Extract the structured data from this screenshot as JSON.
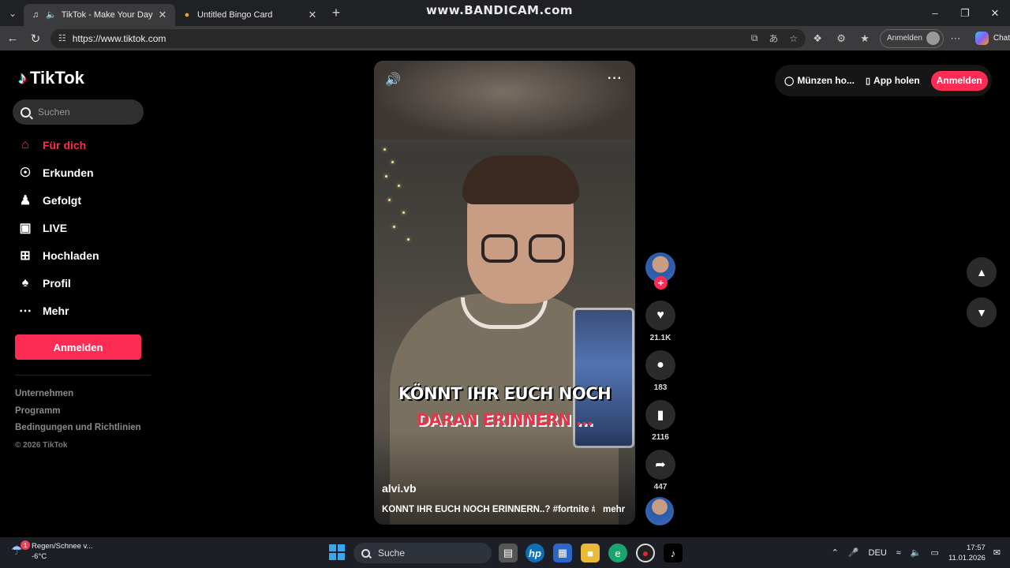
{
  "browser": {
    "tabs": [
      {
        "label": "TikTok - Make Your Day",
        "active": true
      },
      {
        "label": "Untitled Bingo Card",
        "active": false
      }
    ],
    "watermark": "www.BANDICAM.com",
    "url": "https://www.tiktok.com",
    "profile_label": "Anmelden",
    "chat_label": "Chat"
  },
  "sidebar": {
    "logo": "TikTok",
    "search_placeholder": "Suchen",
    "items": [
      {
        "label": "Für dich",
        "icon": "home-icon",
        "active": true
      },
      {
        "label": "Erkunden",
        "icon": "compass-icon"
      },
      {
        "label": "Gefolgt",
        "icon": "following-icon"
      },
      {
        "label": "LIVE",
        "icon": "live-tv-icon"
      },
      {
        "label": "Hochladen",
        "icon": "upload-icon"
      },
      {
        "label": "Profil",
        "icon": "profile-icon"
      },
      {
        "label": "Mehr",
        "icon": "more-dots-icon"
      }
    ],
    "login_button": "Anmelden",
    "footer": [
      "Unternehmen",
      "Programm",
      "Bedingungen und Richtlinien"
    ],
    "copyright": "© 2026 TikTok"
  },
  "video": {
    "overlay_line1": "KÖNNT IHR EUCH NOCH",
    "overlay_line2": "DARAN ERINNERN ...",
    "author": "alvi.vb",
    "description": "KÖNNT IHR EUCH NOCH ERINNERN..? #fortnite #f...",
    "more_label": "mehr"
  },
  "actions": {
    "likes": "21.1K",
    "comments": "183",
    "saves": "2116",
    "shares": "447"
  },
  "topright": {
    "coins": "Münzen ho...",
    "app": "App holen",
    "login": "Anmelden"
  },
  "taskbar": {
    "weather_line1": "Regen/Schnee v...",
    "weather_line2": "-6°C",
    "weather_badge": "1",
    "search": "Suche",
    "lang": "DEU",
    "time": "17:57",
    "date": "11.01.2026"
  },
  "colors": {
    "accent": "#fe2c55",
    "background": "#000000"
  }
}
